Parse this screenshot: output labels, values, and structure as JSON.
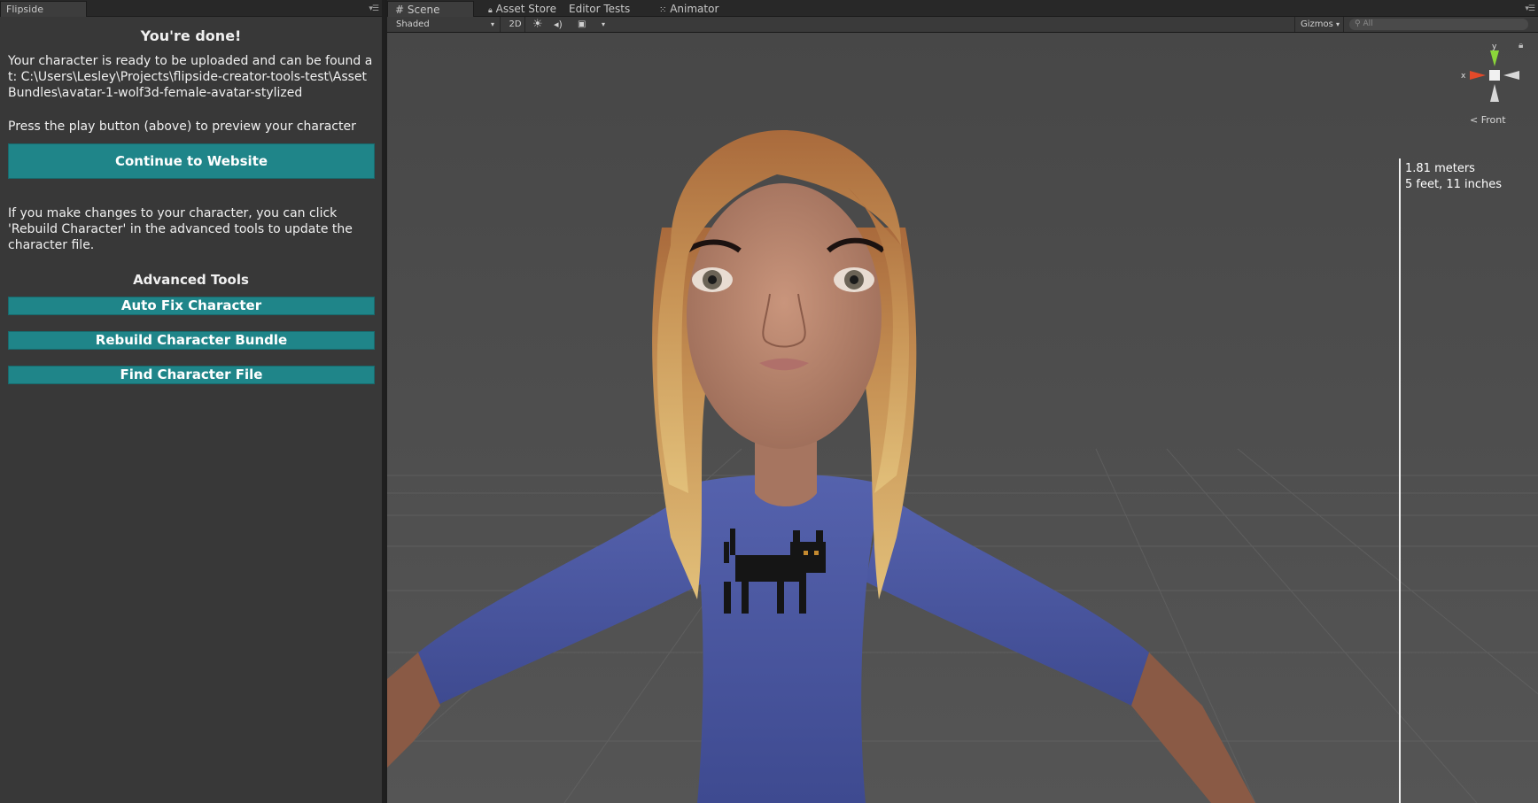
{
  "left_panel": {
    "tab_label": "Flipside",
    "done_title": "You're done!",
    "upload_message": "Your character is ready to be uploaded and can be found at: C:\\Users\\Lesley\\Projects\\flipside-creator-tools-test\\AssetBundles\\avatar-1-wolf3d-female-avatar-stylized",
    "preview_message": "Press the play button (above) to preview your character",
    "continue_button": "Continue to Website",
    "rebuild_message": "If you make changes to your character, you can click 'Rebuild Character' in the advanced tools to update the character file.",
    "advanced_title": "Advanced Tools",
    "auto_fix_button": "Auto Fix Character",
    "rebuild_button": "Rebuild Character Bundle",
    "find_button": "Find Character File"
  },
  "scene_tabs": [
    {
      "label": "Scene",
      "icon": "grid-icon",
      "active": true
    },
    {
      "label": "Asset Store",
      "icon": "lock-icon",
      "active": false
    },
    {
      "label": "Editor Tests",
      "active": false
    },
    {
      "label": "Animator",
      "icon": "animator-icon",
      "active": false
    }
  ],
  "toolbar": {
    "shading_mode": "Shaded",
    "mode_2d": "2D",
    "gizmos_label": "Gizmos",
    "search_placeholder": "All"
  },
  "viewport": {
    "axis_y": "y",
    "axis_x": "x",
    "view_label": "Front",
    "height_meters": "1.81 meters",
    "height_imperial": "5 feet, 11 inches"
  },
  "colors": {
    "accent_button": "#1f8589",
    "panel_bg": "#383838",
    "viewport_bg": "#4a4a4a"
  }
}
